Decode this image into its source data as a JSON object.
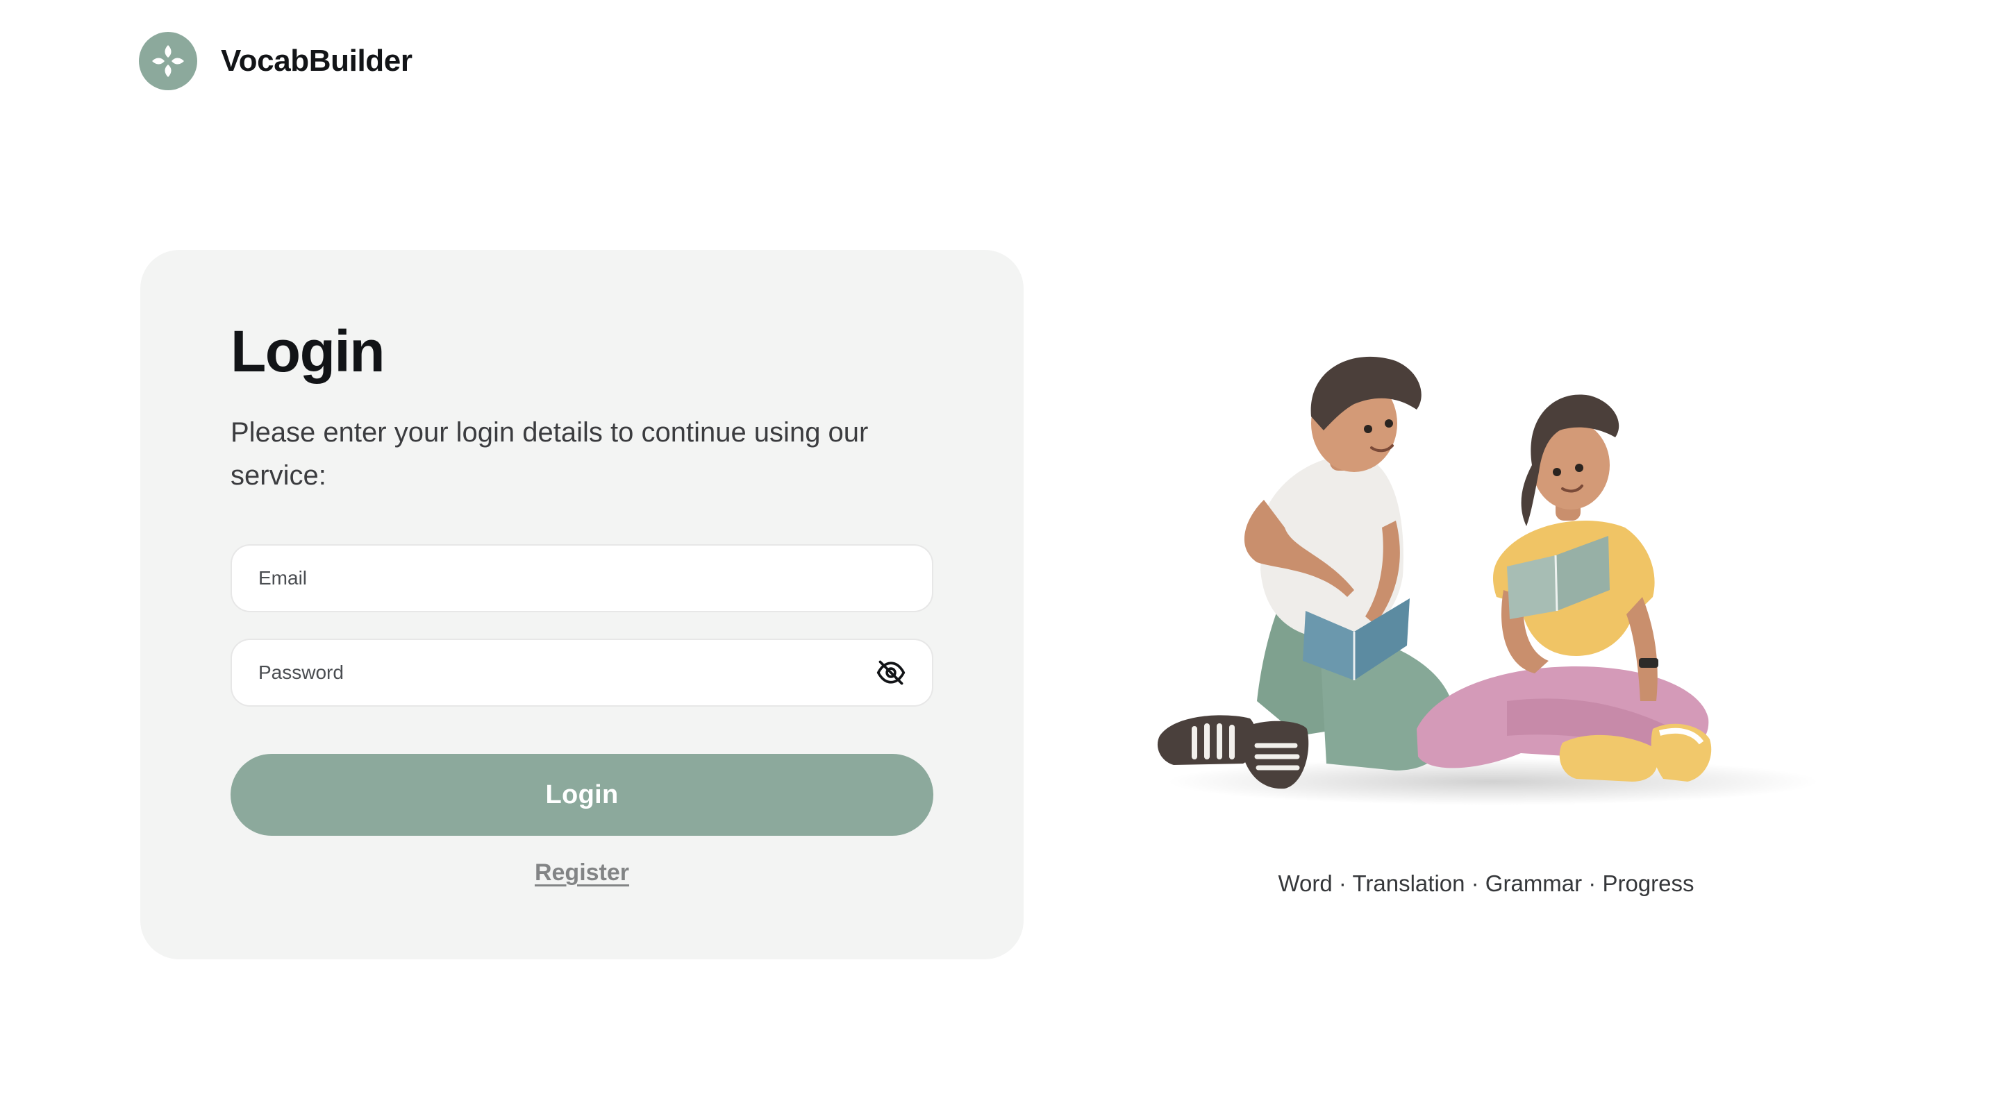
{
  "brand": {
    "name": "VocabBuilder",
    "logo_icon": "clover-logo-icon",
    "color": "#8ca99c"
  },
  "login_card": {
    "title": "Login",
    "subtitle": "Please enter your login details to continue using our service:",
    "email_placeholder": "Email",
    "password_placeholder": "Password",
    "password_toggle_icon": "eye-off-icon",
    "submit_label": "Login",
    "register_label": "Register"
  },
  "hero": {
    "illustration": "two-students-reading-books-illustration",
    "tagline": "Word · Translation · Grammar · Progress"
  },
  "colors": {
    "accent": "#8ca99c",
    "card_bg": "#f3f4f3",
    "text": "#121417"
  }
}
